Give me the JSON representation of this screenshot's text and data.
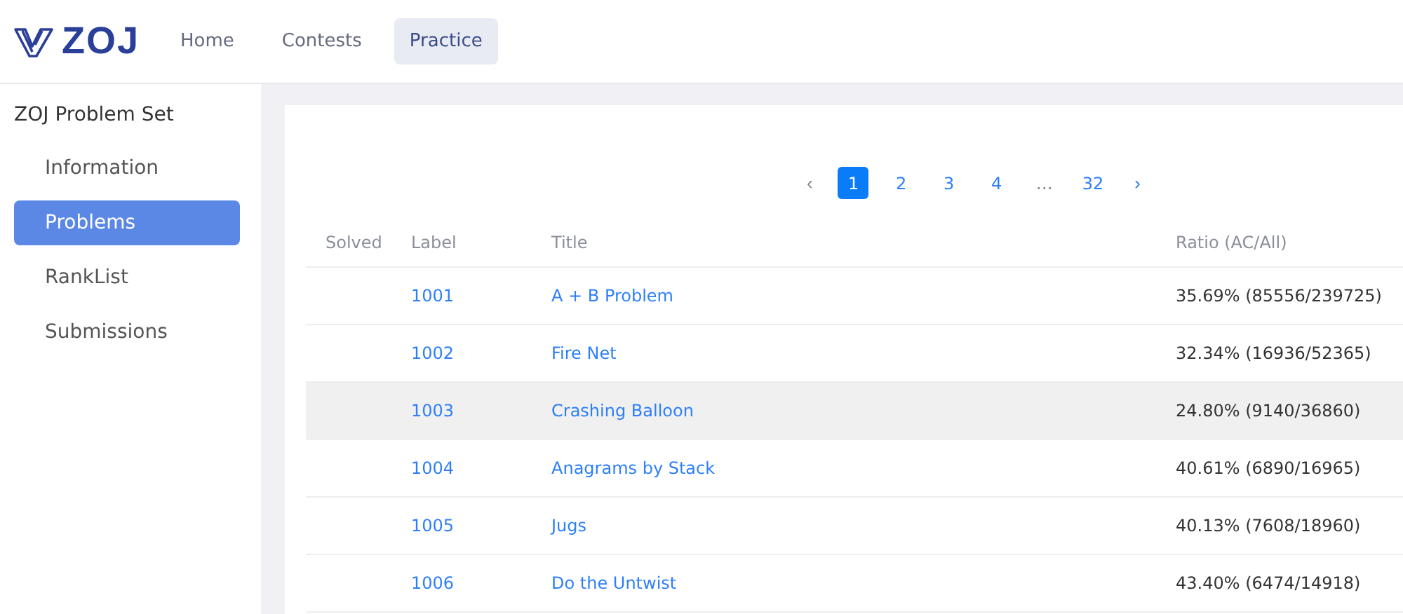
{
  "header": {
    "logo": "ZOJ",
    "nav": [
      {
        "label": "Home",
        "selected": false
      },
      {
        "label": "Contests",
        "selected": false
      },
      {
        "label": "Practice",
        "selected": true
      }
    ]
  },
  "sidebar": {
    "title": "ZOJ Problem Set",
    "items": [
      {
        "label": "Information",
        "selected": false
      },
      {
        "label": "Problems",
        "selected": true
      },
      {
        "label": "RankList",
        "selected": false
      },
      {
        "label": "Submissions",
        "selected": false
      }
    ]
  },
  "pagination": {
    "prev": "‹",
    "pages": [
      {
        "label": "1",
        "selected": true
      },
      {
        "label": "2",
        "selected": false
      },
      {
        "label": "3",
        "selected": false
      },
      {
        "label": "4",
        "selected": false
      },
      {
        "label": "…",
        "selected": false
      },
      {
        "label": "32",
        "selected": false
      }
    ],
    "next": "›"
  },
  "table": {
    "columns": [
      "Solved",
      "Label",
      "Title",
      "Ratio (AC/All)"
    ],
    "rows": [
      {
        "label": "1001",
        "title": "A + B Problem",
        "ratio": "35.69% (85556/239725)",
        "highlighted": false
      },
      {
        "label": "1002",
        "title": "Fire Net",
        "ratio": "32.34% (16936/52365)",
        "highlighted": false
      },
      {
        "label": "1003",
        "title": "Crashing Balloon",
        "ratio": "24.80% (9140/36860)",
        "highlighted": true
      },
      {
        "label": "1004",
        "title": "Anagrams by Stack",
        "ratio": "40.61% (6890/16965)",
        "highlighted": false
      },
      {
        "label": "1005",
        "title": "Jugs",
        "ratio": "40.13% (7608/18960)",
        "highlighted": false
      },
      {
        "label": "1006",
        "title": "Do the Untwist",
        "ratio": "43.40% (6474/14918)",
        "highlighted": false
      }
    ]
  }
}
